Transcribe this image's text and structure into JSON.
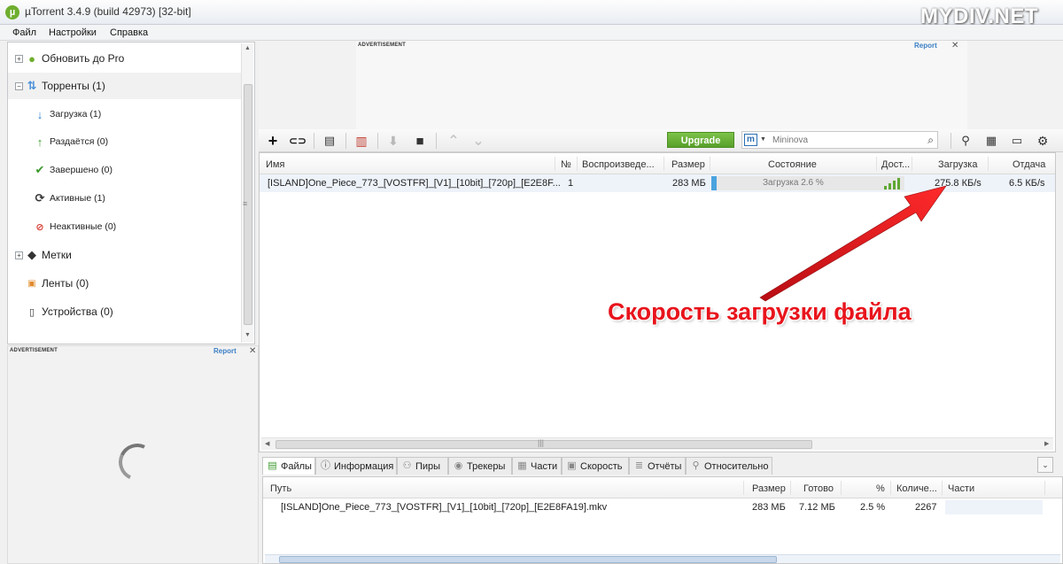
{
  "window": {
    "title": "µTorrent 3.4.9  (build 42973) [32-bit]",
    "watermark": "MYDIV.NET",
    "app_icon": "utorrent-logo"
  },
  "menu": [
    "Файл",
    "Настройки",
    "Справка"
  ],
  "sidebar": {
    "items": [
      {
        "label": "Обновить до Pro",
        "icon": "utorrent-pro-icon"
      },
      {
        "label": "Торренты (1)",
        "icon": "torrents-icon"
      },
      {
        "label": "Загрузка (1)",
        "icon": "download-arrow-icon"
      },
      {
        "label": "Раздаётся (0)",
        "icon": "upload-arrow-icon"
      },
      {
        "label": "Завершено (0)",
        "icon": "checkmark-icon"
      },
      {
        "label": "Активные (1)",
        "icon": "refresh-icon"
      },
      {
        "label": "Неактивные (0)",
        "icon": "inactive-icon"
      },
      {
        "label": "Метки",
        "icon": "tag-icon"
      },
      {
        "label": "Ленты (0)",
        "icon": "rss-icon"
      },
      {
        "label": "Устройства (0)",
        "icon": "device-icon"
      }
    ]
  },
  "ads": {
    "label": "ADVERTISEMENT",
    "report": "Report",
    "close": "✕"
  },
  "toolbar": {
    "upgrade_label": "Upgrade",
    "search_engine": "m",
    "search_placeholder": "Mininova"
  },
  "torrent_list": {
    "columns": [
      "Имя",
      "№",
      "Воспроизведе...",
      "Размер",
      "Состояние",
      "Дост...",
      "Загрузка",
      "Отдача"
    ],
    "rows": [
      {
        "name": "[ISLAND]One_Piece_773_[VOSTFR]_[V1]_[10bit]_[720p]_[E2E8F...",
        "number": "1",
        "size": "283 МБ",
        "status": "Загрузка 2.6 %",
        "progress": 0.026,
        "download_speed": "275.8 КБ/s",
        "upload_speed": "6.5 КБ/s"
      }
    ]
  },
  "annotation": {
    "text": "Скорость загрузки файла",
    "color": "#e8141c"
  },
  "tabs": [
    {
      "label": "Файлы",
      "icon": "files-icon"
    },
    {
      "label": "Информация",
      "icon": "info-icon"
    },
    {
      "label": "Пиры",
      "icon": "peers-icon"
    },
    {
      "label": "Трекеры",
      "icon": "trackers-icon"
    },
    {
      "label": "Части",
      "icon": "pieces-icon"
    },
    {
      "label": "Скорость",
      "icon": "speed-icon"
    },
    {
      "label": "Отчёты",
      "icon": "logger-icon"
    },
    {
      "label": "Относительно",
      "icon": "relative-icon"
    }
  ],
  "files_panel": {
    "columns": [
      "Путь",
      "Размер",
      "Готово",
      "%",
      "Количе...",
      "Части"
    ],
    "rows": [
      {
        "path": "[ISLAND]One_Piece_773_[VOSTFR]_[V1]_[10bit]_[720p]_[E2E8FA19].mkv",
        "size": "283 МБ",
        "done": "7.12 МБ",
        "percent": "2.5 %",
        "count": "2267"
      }
    ]
  },
  "colors": {
    "accent_green": "#58a02a",
    "selection_blue": "#eef3fa",
    "progress_blue": "#4aa3df",
    "delete_red": "#c0392b"
  }
}
